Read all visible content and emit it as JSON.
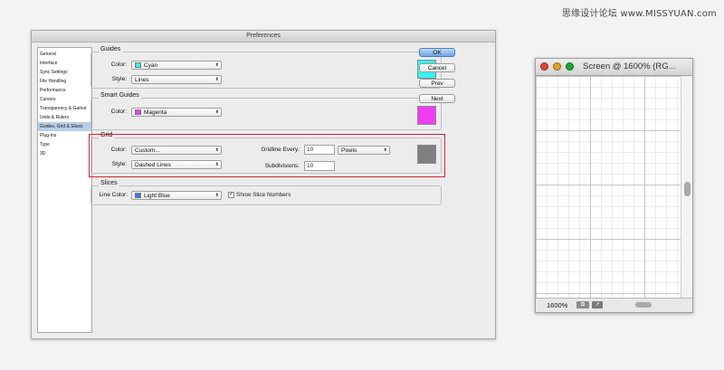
{
  "watermark": "思缘设计论坛  www.MISSYUAN.com",
  "dialog": {
    "title": "Preferences",
    "sidebar": {
      "items": [
        {
          "label": "General"
        },
        {
          "label": "Interface"
        },
        {
          "label": "Sync Settings"
        },
        {
          "label": "File Handling"
        },
        {
          "label": "Performance"
        },
        {
          "label": "Cursors"
        },
        {
          "label": "Transparency & Gamut"
        },
        {
          "label": "Units & Rulers"
        },
        {
          "label": "Guides, Grid & Slices"
        },
        {
          "label": "Plug-Ins"
        },
        {
          "label": "Type"
        },
        {
          "label": "3D"
        }
      ],
      "selected_index": 8
    },
    "guides": {
      "title": "Guides",
      "color_label": "Color:",
      "color_value": "Cyan",
      "color_hex": "#33f5f5",
      "style_label": "Style:",
      "style_value": "Lines"
    },
    "smart_guides": {
      "title": "Smart Guides",
      "color_label": "Color:",
      "color_value": "Magenta",
      "color_hex": "#f23cf0"
    },
    "grid": {
      "title": "Grid",
      "color_label": "Color:",
      "color_value": "Custom...",
      "color_hex": "#808080",
      "style_label": "Style:",
      "style_value": "Dashed Lines",
      "gridline_label": "Gridline Every:",
      "gridline_value": "10",
      "unit_value": "Pixels",
      "subdivisions_label": "Subdivisions:",
      "subdivisions_value": "10"
    },
    "slices": {
      "title": "Slices",
      "line_color_label": "Line Color:",
      "line_color_value": "Light Blue",
      "line_color_hex": "#3c78e6",
      "show_numbers_label": "Show Slice Numbers",
      "show_numbers_checked": true
    },
    "buttons": {
      "ok": "OK",
      "cancel": "Cancel",
      "prev": "Prev",
      "next": "Next"
    }
  },
  "canvas_window": {
    "title": "Screen @ 1600% (RG...",
    "zoom": "1600%"
  }
}
